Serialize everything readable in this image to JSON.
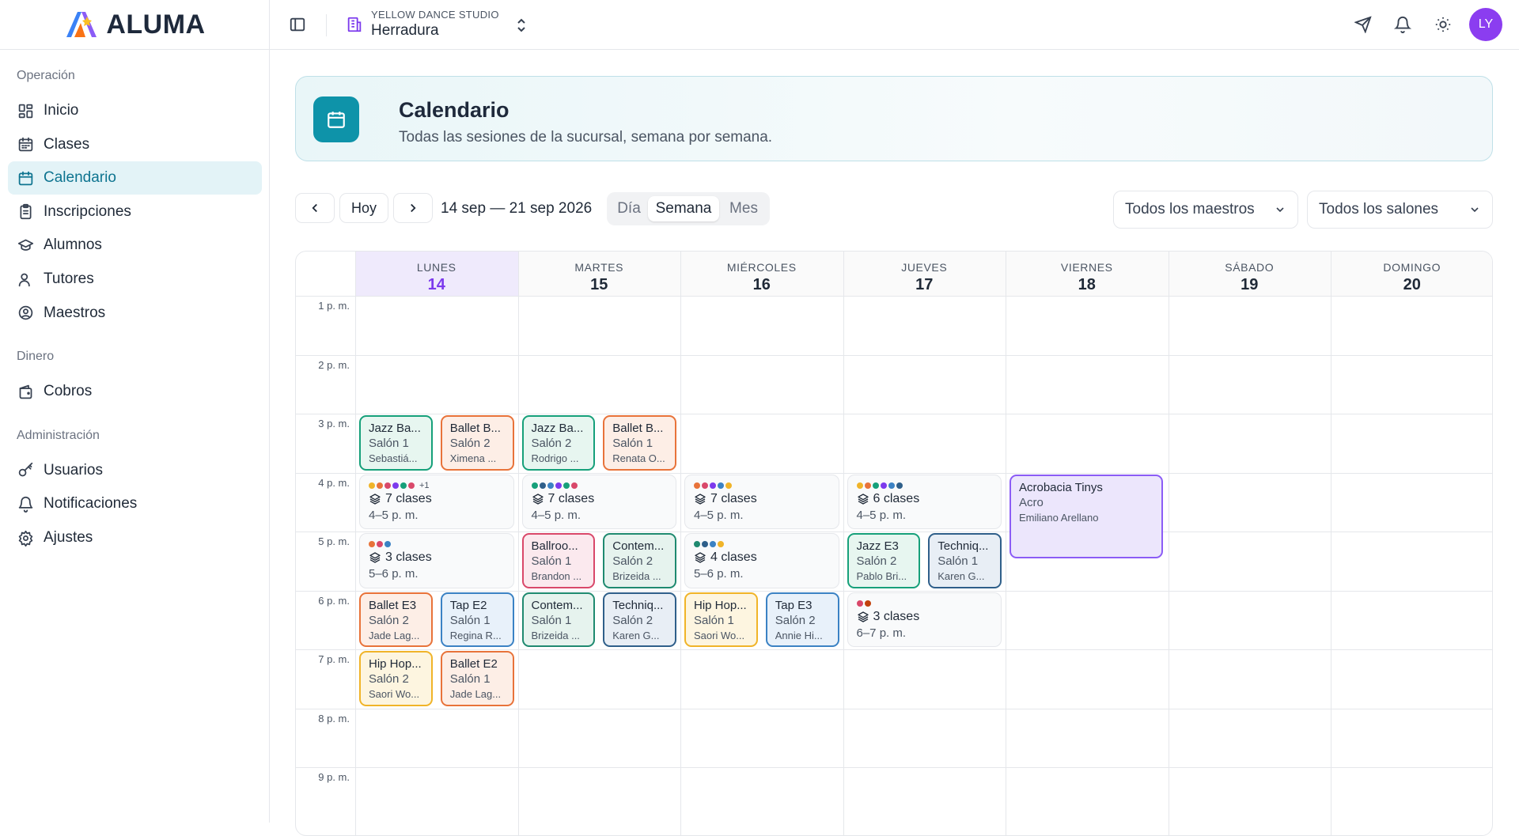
{
  "brand": {
    "name": "ALUMA"
  },
  "sidebar": {
    "sections": [
      {
        "label": "Operación",
        "items": [
          {
            "label": "Inicio",
            "icon": "dashboard-icon"
          },
          {
            "label": "Clases",
            "icon": "calendar-list-icon"
          },
          {
            "label": "Calendario",
            "icon": "calendar-icon",
            "active": true
          },
          {
            "label": "Inscripciones",
            "icon": "clipboard-icon"
          },
          {
            "label": "Alumnos",
            "icon": "graduation-cap-icon"
          },
          {
            "label": "Tutores",
            "icon": "users-icon"
          },
          {
            "label": "Maestros",
            "icon": "user-circle-icon"
          }
        ]
      },
      {
        "label": "Dinero",
        "items": [
          {
            "label": "Cobros",
            "icon": "wallet-icon"
          }
        ]
      },
      {
        "label": "Administración",
        "items": [
          {
            "label": "Usuarios",
            "icon": "key-icon"
          },
          {
            "label": "Notificaciones",
            "icon": "bell-icon"
          },
          {
            "label": "Ajustes",
            "icon": "gear-icon"
          }
        ]
      }
    ]
  },
  "topbar": {
    "org": "YELLOW DANCE STUDIO",
    "branch": "Herradura",
    "avatar": "LY"
  },
  "page": {
    "title": "Calendario",
    "subtitle": "Todas las sesiones de la sucursal, semana por semana."
  },
  "toolbar": {
    "today": "Hoy",
    "range": "14 sep — 21 sep 2026",
    "views": [
      "Día",
      "Semana",
      "Mes"
    ],
    "active_view": "Semana",
    "teacher_filter": "Todos los maestros",
    "room_filter": "Todos los salones"
  },
  "colors": {
    "accent": "#0e93a9",
    "brand_purple": "#7c3aed",
    "event_green": "#16a07a",
    "event_orange": "#e8733a",
    "event_blue": "#3b82c4",
    "event_teal": "#1f8a70",
    "event_yellow": "#f0b429",
    "event_pink": "#d9486a",
    "event_navy": "#2f5f8a",
    "event_purple": "#8b5cf6"
  },
  "calendar": {
    "days": [
      {
        "name": "LUNES",
        "date": "14",
        "today": true
      },
      {
        "name": "MARTES",
        "date": "15"
      },
      {
        "name": "MIÉRCOLES",
        "date": "16"
      },
      {
        "name": "JUEVES",
        "date": "17"
      },
      {
        "name": "VIERNES",
        "date": "18"
      },
      {
        "name": "SÁBADO",
        "date": "19"
      },
      {
        "name": "DOMINGO",
        "date": "20"
      }
    ],
    "hours": [
      "1 p. m.",
      "2 p. m.",
      "3 p. m.",
      "4 p. m.",
      "5 p. m.",
      "6 p. m.",
      "7 p. m.",
      "8 p. m.",
      "9 p. m."
    ],
    "events": [
      {
        "day": 0,
        "start": 15,
        "end": 16,
        "col": 0,
        "cols": 2,
        "title": "Jazz Ba...",
        "room": "Salón 1",
        "teacher": "Sebastiá...",
        "color": "green"
      },
      {
        "day": 0,
        "start": 15,
        "end": 16,
        "col": 1,
        "cols": 2,
        "title": "Ballet B...",
        "room": "Salón 2",
        "teacher": "Ximena ...",
        "color": "orange"
      },
      {
        "day": 1,
        "start": 15,
        "end": 16,
        "col": 0,
        "cols": 2,
        "title": "Jazz Ba...",
        "room": "Salón 2",
        "teacher": "Rodrigo ...",
        "color": "green"
      },
      {
        "day": 1,
        "start": 15,
        "end": 16,
        "col": 1,
        "cols": 2,
        "title": "Ballet B...",
        "room": "Salón 1",
        "teacher": "Renata O...",
        "color": "orange"
      },
      {
        "day": 4,
        "start": 16,
        "end": 17.5,
        "col": 0,
        "cols": 1,
        "title": "Acrobacia Tinys",
        "room": "Acro",
        "teacher": "Emiliano Arellano",
        "color": "purple"
      },
      {
        "day": 1,
        "start": 17,
        "end": 18,
        "col": 0,
        "cols": 2,
        "title": "Ballroo...",
        "room": "Salón 1",
        "teacher": "Brandon ...",
        "color": "pink"
      },
      {
        "day": 1,
        "start": 17,
        "end": 18,
        "col": 1,
        "cols": 2,
        "title": "Contem...",
        "room": "Salón 2",
        "teacher": "Brizeida ...",
        "color": "teal"
      },
      {
        "day": 3,
        "start": 17,
        "end": 18,
        "col": 0,
        "cols": 2,
        "title": "Jazz E3",
        "room": "Salón 2",
        "teacher": "Pablo Bri...",
        "color": "green"
      },
      {
        "day": 3,
        "start": 17,
        "end": 18,
        "col": 1,
        "cols": 2,
        "title": "Techniq...",
        "room": "Salón 1",
        "teacher": "Karen G...",
        "color": "navy"
      },
      {
        "day": 0,
        "start": 18,
        "end": 19,
        "col": 0,
        "cols": 2,
        "title": "Ballet E3",
        "room": "Salón 2",
        "teacher": "Jade Lag...",
        "color": "orange"
      },
      {
        "day": 0,
        "start": 18,
        "end": 19,
        "col": 1,
        "cols": 2,
        "title": "Tap E2",
        "room": "Salón 1",
        "teacher": "Regina R...",
        "color": "blue"
      },
      {
        "day": 1,
        "start": 18,
        "end": 19,
        "col": 0,
        "cols": 2,
        "title": "Contem...",
        "room": "Salón 1",
        "teacher": "Brizeida ...",
        "color": "teal"
      },
      {
        "day": 1,
        "start": 18,
        "end": 19,
        "col": 1,
        "cols": 2,
        "title": "Techniq...",
        "room": "Salón 2",
        "teacher": "Karen G...",
        "color": "navy"
      },
      {
        "day": 2,
        "start": 18,
        "end": 19,
        "col": 0,
        "cols": 2,
        "title": "Hip Hop...",
        "room": "Salón 1",
        "teacher": "Saori Wo...",
        "color": "yellow"
      },
      {
        "day": 2,
        "start": 18,
        "end": 19,
        "col": 1,
        "cols": 2,
        "title": "Tap E3",
        "room": "Salón 2",
        "teacher": "Annie Hi...",
        "color": "blue"
      },
      {
        "day": 0,
        "start": 19,
        "end": 20,
        "col": 0,
        "cols": 2,
        "title": "Hip Hop...",
        "room": "Salón 2",
        "teacher": "Saori Wo...",
        "color": "yellow"
      },
      {
        "day": 0,
        "start": 19,
        "end": 20,
        "col": 1,
        "cols": 2,
        "title": "Ballet E2",
        "room": "Salón 1",
        "teacher": "Jade Lag...",
        "color": "orange"
      }
    ],
    "groups": [
      {
        "day": 0,
        "start": 16,
        "label": "7 clases",
        "time": "4–5 p. m.",
        "dots": [
          "#f0b429",
          "#e8733a",
          "#d9486a",
          "#7c3aed",
          "#16a07a",
          "#d9486a"
        ],
        "more": "+1"
      },
      {
        "day": 1,
        "start": 16,
        "label": "7 clases",
        "time": "4–5 p. m.",
        "dots": [
          "#16a07a",
          "#2f5f8a",
          "#3b82c4",
          "#7c3aed",
          "#16a07a",
          "#d9486a"
        ]
      },
      {
        "day": 2,
        "start": 16,
        "label": "7 clases",
        "time": "4–5 p. m.",
        "dots": [
          "#e8733a",
          "#d9486a",
          "#7c3aed",
          "#3b82c4",
          "#f0b429"
        ]
      },
      {
        "day": 3,
        "start": 16,
        "label": "6 clases",
        "time": "4–5 p. m.",
        "dots": [
          "#f0b429",
          "#e8733a",
          "#16a07a",
          "#7c3aed",
          "#3b82c4",
          "#2f5f8a"
        ]
      },
      {
        "day": 0,
        "start": 17,
        "label": "3 clases",
        "time": "5–6 p. m.",
        "dots": [
          "#e8733a",
          "#d9486a",
          "#3b82c4"
        ]
      },
      {
        "day": 2,
        "start": 17,
        "label": "4 clases",
        "time": "5–6 p. m.",
        "dots": [
          "#1f8a70",
          "#2f5f8a",
          "#3b82c4",
          "#f0b429"
        ]
      },
      {
        "day": 3,
        "start": 18,
        "label": "3 clases",
        "time": "6–7 p. m.",
        "dots": [
          "#d9486a",
          "#c2410c"
        ]
      }
    ]
  }
}
